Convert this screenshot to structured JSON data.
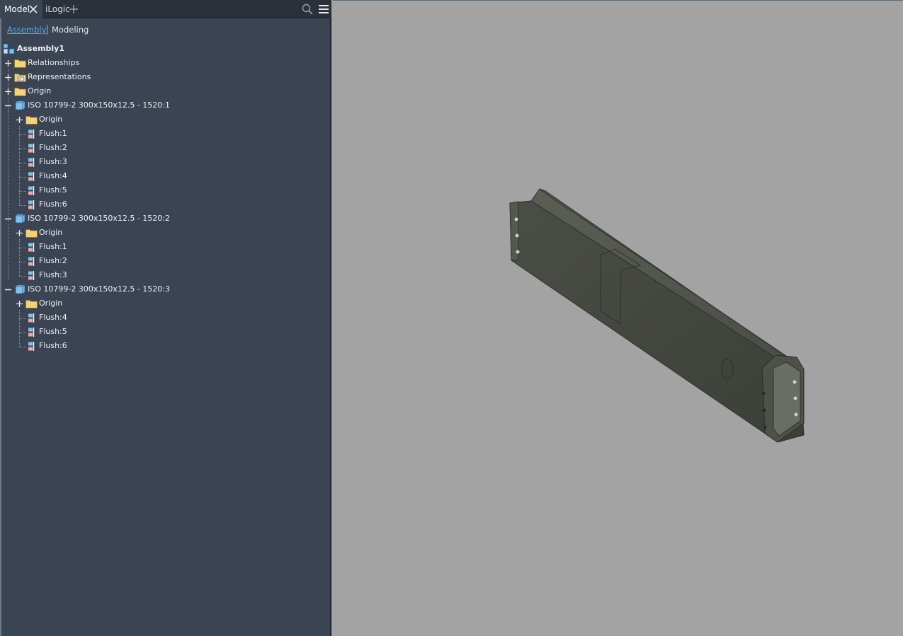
{
  "tabs": {
    "model_label": "Model",
    "ilogic_label": "iLogic"
  },
  "view_switch": {
    "assembly_label": "Assembly",
    "modeling_label": "Modeling"
  },
  "tree": {
    "root": "Assembly1",
    "relationships": "Relationships",
    "representations": "Representations",
    "origin": "Origin",
    "part1": {
      "label": "ISO 10799-2 300x150x12.5 - 1520:1",
      "origin": "Origin",
      "constraints": [
        "Flush:1",
        "Flush:2",
        "Flush:3",
        "Flush:4",
        "Flush:5",
        "Flush:6"
      ]
    },
    "part2": {
      "label": "ISO 10799-2 300x150x12.5 - 1520:2",
      "origin": "Origin",
      "constraints": [
        "Flush:1",
        "Flush:2",
        "Flush:3"
      ]
    },
    "part3": {
      "label": "ISO 10799-2 300x150x12.5 - 1520:3",
      "origin": "Origin",
      "constraints": [
        "Flush:4",
        "Flush:5",
        "Flush:6"
      ]
    }
  },
  "colors": {
    "panel_bg": "#3b4453",
    "tabbar_bg": "#2b313b",
    "viewport_bg": "#a3a3a3",
    "accent": "#5aa7e6",
    "folder": "#f3d27a",
    "part_blue": "#7ec3f0"
  }
}
